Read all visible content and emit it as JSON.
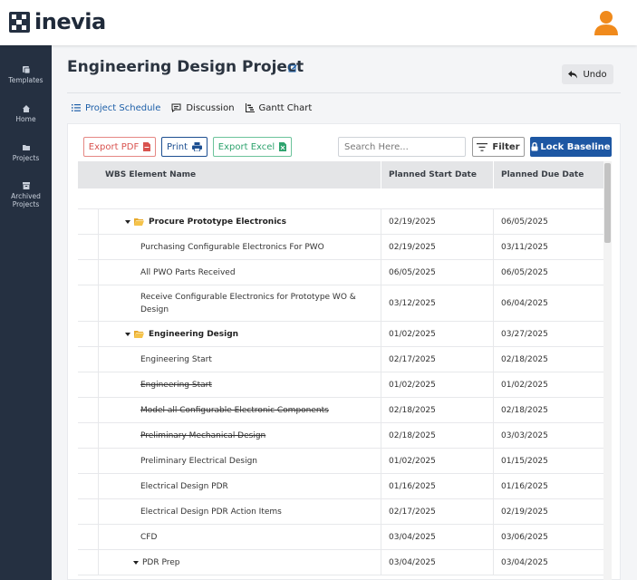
{
  "brand": {
    "name": "inevia"
  },
  "colors": {
    "primary": "#1d57a3",
    "sidebar": "#253041",
    "avatar": "#f08a1c",
    "pdf": "#d9534f",
    "excel": "#2ea36e"
  },
  "sidebar": {
    "items": [
      {
        "label": "Templates",
        "icon": "templates-icon"
      },
      {
        "label": "Home",
        "icon": "home-icon"
      },
      {
        "label": "Projects",
        "icon": "folder-icon"
      },
      {
        "label": "Archived Projects",
        "icon": "archive-icon"
      }
    ]
  },
  "header": {
    "title": "Engineering Design Project",
    "undo_label": "Undo"
  },
  "tabs": [
    {
      "label": "Project Schedule",
      "active": true
    },
    {
      "label": "Discussion",
      "active": false
    },
    {
      "label": "Gantt Chart",
      "active": false
    }
  ],
  "toolbar": {
    "export_pdf": "Export PDF",
    "print": "Print",
    "export_excel": "Export Excel",
    "search_placeholder": "Search Here...",
    "filter": "Filter",
    "lock_baseline": "Lock Baseline"
  },
  "table": {
    "columns": [
      "WBS Element Name",
      "Planned Start Date",
      "Planned Due Date"
    ],
    "rows": [
      {
        "name": "Procure Prototype Electronics",
        "start": "02/19/2025",
        "due": "06/05/2025"
      },
      {
        "name": "Purchasing Configurable Electronics For PWO",
        "start": "02/19/2025",
        "due": "03/11/2025"
      },
      {
        "name": "All PWO Parts Received",
        "start": "06/05/2025",
        "due": "06/05/2025"
      },
      {
        "name": "Receive Configurable Electronics for Prototype WO & Design",
        "start": "03/12/2025",
        "due": "06/04/2025"
      },
      {
        "name": "Engineering Design",
        "start": "01/02/2025",
        "due": "03/27/2025"
      },
      {
        "name": "Engineering Start",
        "start": "02/17/2025",
        "due": "02/18/2025"
      },
      {
        "name": "Engineering Start",
        "start": "01/02/2025",
        "due": "01/02/2025"
      },
      {
        "name": "Model all Configurable Electronic Components",
        "start": "02/18/2025",
        "due": "02/18/2025"
      },
      {
        "name": "Preliminary Mechanical Design",
        "start": "02/18/2025",
        "due": "03/03/2025"
      },
      {
        "name": "Preliminary Electrical Design",
        "start": "01/02/2025",
        "due": "01/15/2025"
      },
      {
        "name": "Electrical Design PDR",
        "start": "01/16/2025",
        "due": "01/16/2025"
      },
      {
        "name": "Electrical Design PDR Action Items",
        "start": "02/17/2025",
        "due": "02/19/2025"
      },
      {
        "name": "CFD",
        "start": "03/04/2025",
        "due": "03/06/2025"
      },
      {
        "name": "PDR Prep",
        "start": "03/04/2025",
        "due": "03/04/2025"
      }
    ]
  }
}
